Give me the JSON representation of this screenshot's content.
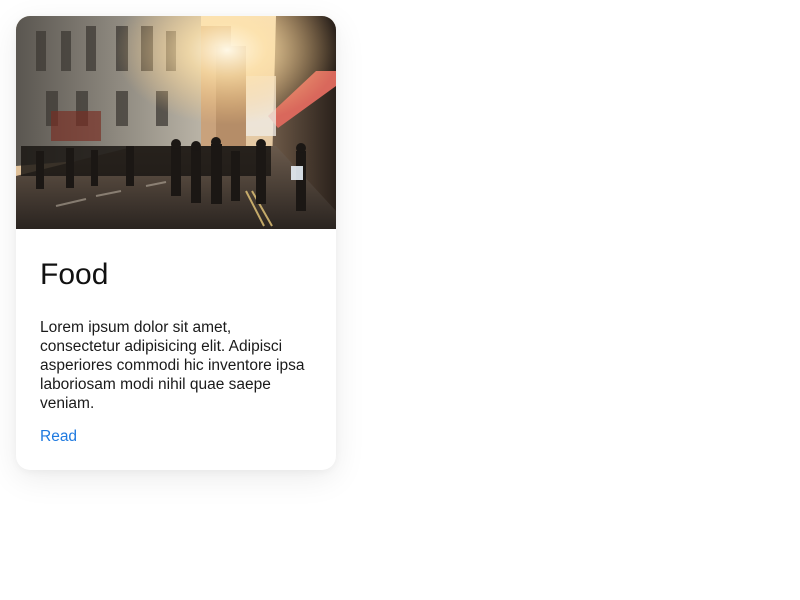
{
  "card": {
    "image_alt": "",
    "title": "Food",
    "text": "Lorem ipsum dolor sit amet, consectetur adipisicing elit. Adipisci asperiores commodi hic inventore ipsa laboriosam modi nihil quae saepe veniam.",
    "link_label": "Read",
    "link_color": "#1f7ae0"
  }
}
